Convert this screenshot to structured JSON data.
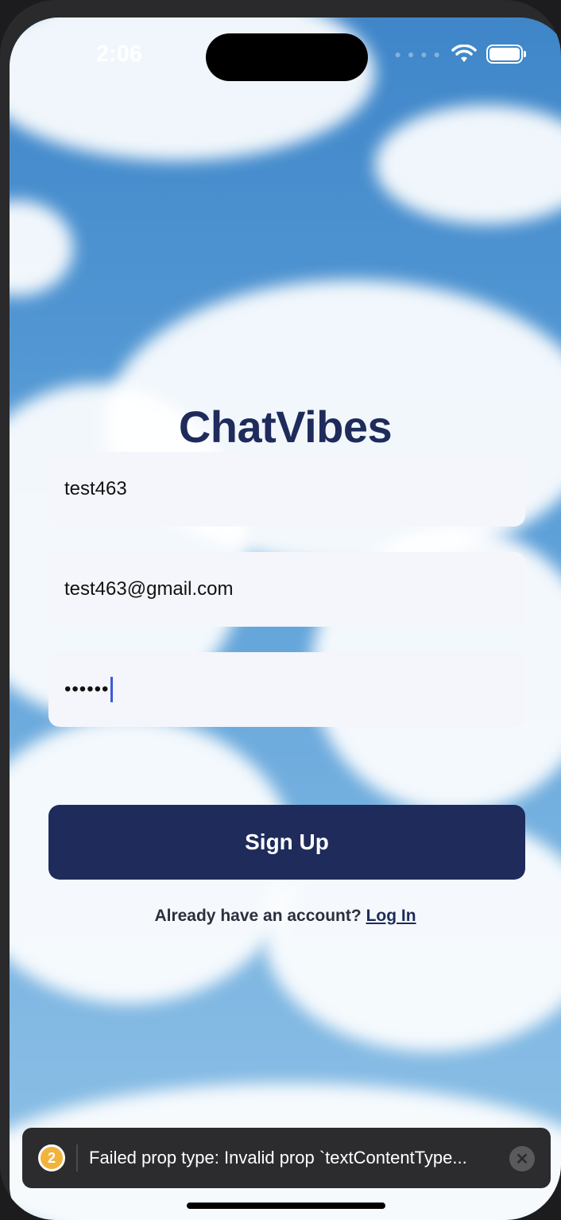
{
  "status_bar": {
    "time": "2:06",
    "icons": [
      "signal-dots",
      "wifi-icon",
      "battery-icon"
    ]
  },
  "app": {
    "title": "ChatVibes"
  },
  "form": {
    "username_value": "test463",
    "email_value": "test463@gmail.com",
    "password_masked": "••••••"
  },
  "actions": {
    "signup_label": "Sign Up",
    "login_prompt": "Already have an account?",
    "login_link": "Log In"
  },
  "toast": {
    "count": "2",
    "message": "Failed prop type: Invalid prop `textContentType..."
  },
  "colors": {
    "brand": "#1e2b5b",
    "field_bg": "#f5f6fb",
    "toast_bg": "#2c2c2e",
    "badge": "#f2b33d"
  }
}
